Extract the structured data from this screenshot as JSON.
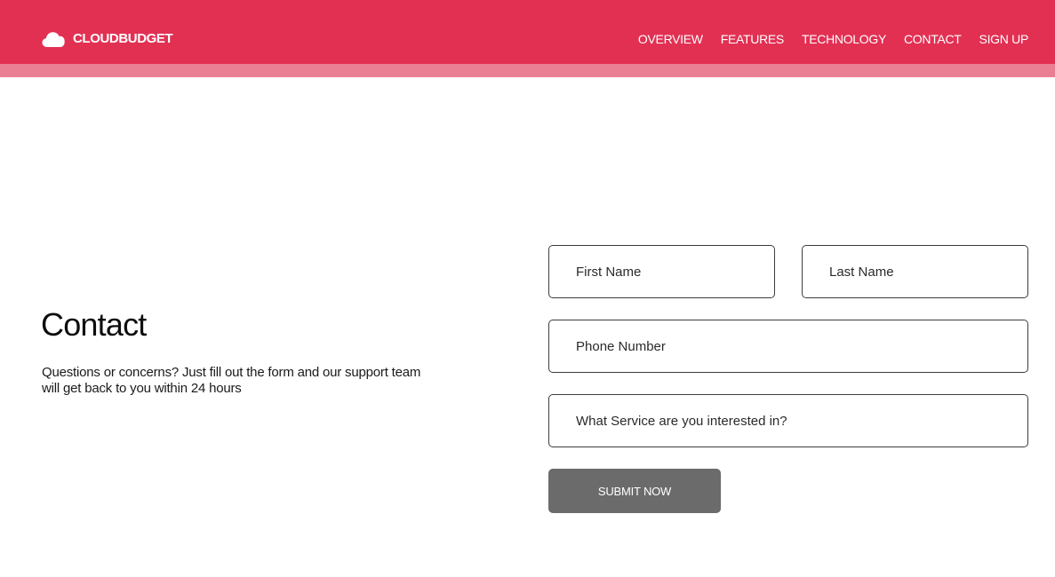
{
  "header": {
    "brand": {
      "icon": "cloud-icon",
      "name": "CLOUDBUDGET"
    },
    "nav": [
      {
        "label": "OVERVIEW"
      },
      {
        "label": "FEATURES"
      },
      {
        "label": "TECHNOLOGY"
      },
      {
        "label": "CONTACT"
      },
      {
        "label": "SIGN UP"
      }
    ]
  },
  "contact": {
    "title": "Contact",
    "description": "Questions or concerns? Just fill out the form and our support team will get back to you within 24 hours"
  },
  "form": {
    "first_name": {
      "placeholder": "First Name",
      "value": ""
    },
    "last_name": {
      "placeholder": "Last Name",
      "value": ""
    },
    "phone": {
      "placeholder": "Phone Number",
      "value": ""
    },
    "service": {
      "placeholder": "What Service are you interested in?",
      "value": ""
    },
    "submit_label": "SUBMIT NOW"
  },
  "colors": {
    "header_bg": "#e23053",
    "header_strip": "#ea7f93",
    "button_bg": "#6b6b6b",
    "field_border": "#3d3d3d"
  }
}
